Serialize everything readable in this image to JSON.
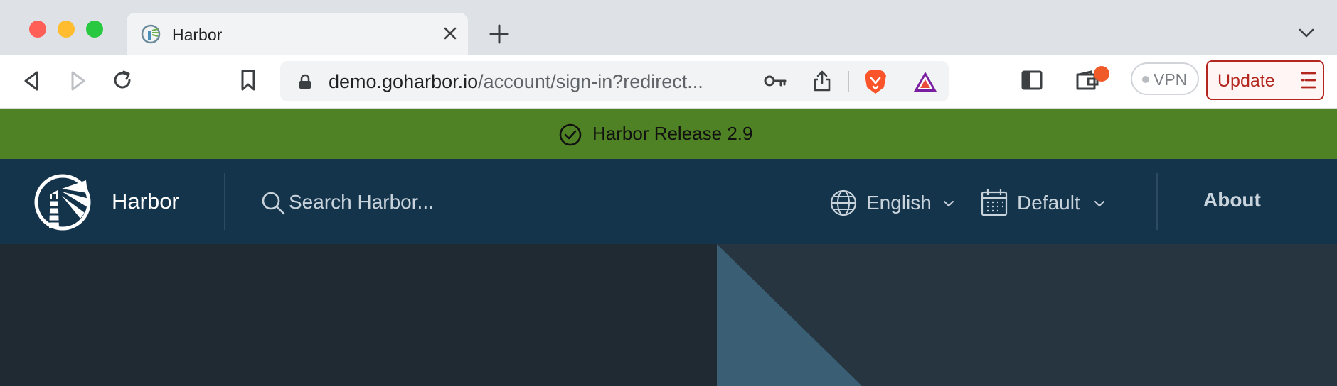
{
  "browser": {
    "tab": {
      "title": "Harbor"
    },
    "url": {
      "domain": "demo.goharbor.io",
      "path": "/account/sign-in?redirect..."
    },
    "vpn_label": "VPN",
    "update_label": "Update",
    "colors": {
      "tabstrip": "#dee1e6",
      "update_accent": "#b3261e",
      "wallet_badge": "#f05a28"
    }
  },
  "banner": {
    "text": "Harbor Release 2.9",
    "color": "#4f8224"
  },
  "header": {
    "brand": "Harbor",
    "search_placeholder": "Search Harbor...",
    "language": "English",
    "theme": "Default",
    "about": "About",
    "color": "#14344c"
  }
}
